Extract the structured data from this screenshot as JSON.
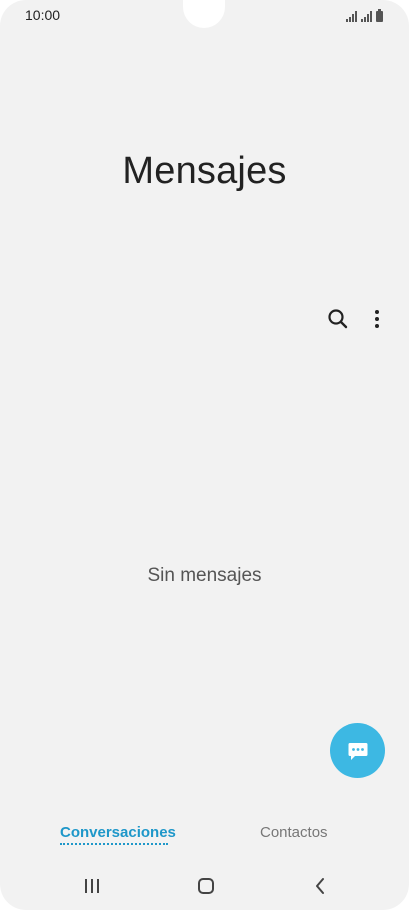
{
  "status_bar": {
    "time": "10:00",
    "icons": [
      "signal-icon",
      "signal-icon",
      "battery-icon"
    ]
  },
  "app": {
    "title": "Mensajes",
    "empty_state": "Sin mensajes"
  },
  "actions": {
    "search_icon": "search-icon",
    "more_icon": "more-vertical-icon",
    "fab_icon": "new-message-icon"
  },
  "tabs": [
    {
      "label": "Conversaciones",
      "selected": true
    },
    {
      "label": "Contactos",
      "selected": false
    }
  ],
  "nav_bar": {
    "icons": [
      "recents-icon",
      "home-icon",
      "back-icon"
    ]
  },
  "colors": {
    "accent": "#1e97c9",
    "fab": "#3db8e3",
    "background": "#f2f2f2"
  }
}
